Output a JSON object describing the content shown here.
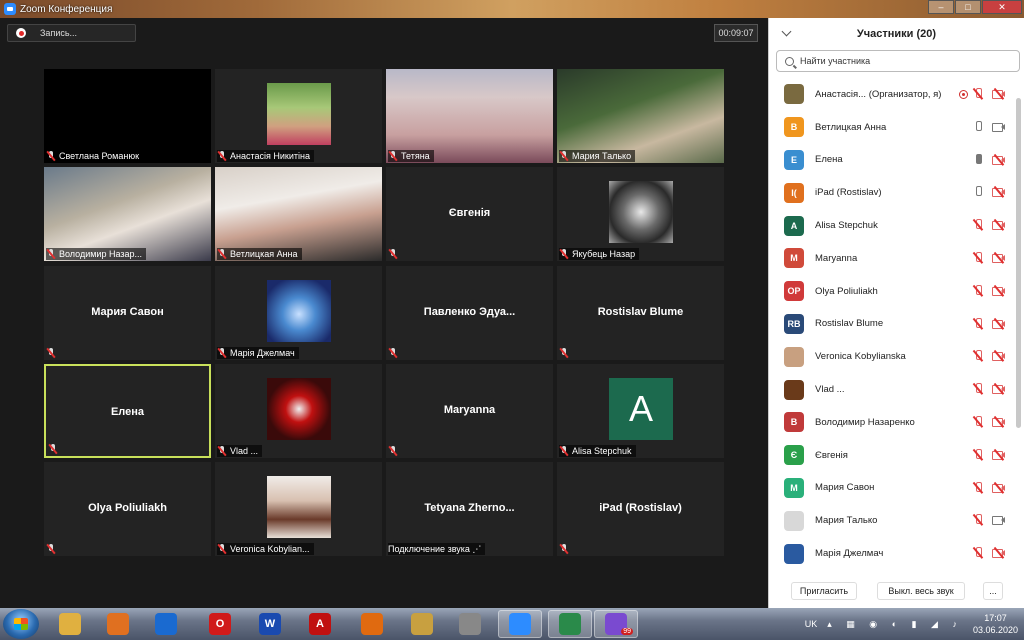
{
  "window": {
    "title": "Zoom Конференция"
  },
  "toolbar": {
    "record_label": "Запись...",
    "timer": "00:09:07"
  },
  "tiles": [
    {
      "name": "Светлана Романюк",
      "kind": "photo"
    },
    {
      "name": "Анастасія Никитіна",
      "kind": "thumb"
    },
    {
      "name": "Тетяна",
      "kind": "photo"
    },
    {
      "name": "Мария Талько",
      "kind": "photo"
    },
    {
      "name": "Володимир Назар...",
      "kind": "photo"
    },
    {
      "name": "Ветлицкая Анна",
      "kind": "photo"
    },
    {
      "name": "Євгенія",
      "kind": "center"
    },
    {
      "name": "Якубець Назар",
      "kind": "thumb"
    },
    {
      "name": "Мария Савон",
      "kind": "center"
    },
    {
      "name": "Марія Джелмач",
      "kind": "thumb"
    },
    {
      "name": "Павленко  Эдуа...",
      "kind": "center"
    },
    {
      "name": "Rostislav Blume",
      "kind": "center"
    },
    {
      "name": "Елена",
      "kind": "center"
    },
    {
      "name": "Vlad ...",
      "kind": "thumb"
    },
    {
      "name": "Maryanna",
      "kind": "center"
    },
    {
      "name": "Alisa Stepchuk",
      "kind": "letter"
    },
    {
      "name": "Olya Poliuliakh",
      "kind": "center"
    },
    {
      "name": "Veronica Kobylian...",
      "kind": "thumb"
    },
    {
      "name": "Tetyana  Zherno...",
      "kind": "center"
    },
    {
      "name": "iPad (Rostislav)",
      "kind": "center"
    }
  ],
  "tile_extra": {
    "connecting_audio": "Подключение звука",
    "alisa_letter": "A"
  },
  "panel": {
    "title": "Участники (20)",
    "search_placeholder": "Найти участника",
    "participants": [
      {
        "name": "Анастасія... (Организатор, я)",
        "initials": "",
        "color": "#7a6a40",
        "mic": "off",
        "cam": "off",
        "rec": true
      },
      {
        "name": "Ветлицкая Анна",
        "initials": "В",
        "color": "#f0961e",
        "mic": "on",
        "cam": "on"
      },
      {
        "name": "Елена",
        "initials": "Е",
        "color": "#3a8ed0",
        "mic": "live",
        "cam": "off"
      },
      {
        "name": "iPad (Rostislav)",
        "initials": "I(",
        "color": "#e0701e",
        "mic": "on",
        "cam": "off"
      },
      {
        "name": "Alisa Stepchuk",
        "initials": "A",
        "color": "#1c6a4e",
        "mic": "off",
        "cam": "off"
      },
      {
        "name": "Maryanna",
        "initials": "M",
        "color": "#d04a3a",
        "mic": "off",
        "cam": "off"
      },
      {
        "name": "Olya Poliuliakh",
        "initials": "OP",
        "color": "#d03a3a",
        "mic": "off",
        "cam": "off"
      },
      {
        "name": "Rostislav Blume",
        "initials": "RB",
        "color": "#2a4a78",
        "mic": "off",
        "cam": "off"
      },
      {
        "name": "Veronica Kobylianska",
        "initials": "",
        "color": "#c8a080",
        "mic": "off",
        "cam": "off"
      },
      {
        "name": "Vlad ...",
        "initials": "",
        "color": "#6a3a1a",
        "mic": "off",
        "cam": "off"
      },
      {
        "name": "Володимир Назаренко",
        "initials": "В",
        "color": "#c03a3a",
        "mic": "off",
        "cam": "off"
      },
      {
        "name": "Євгенія",
        "initials": "Є",
        "color": "#2aa04a",
        "mic": "off",
        "cam": "off"
      },
      {
        "name": "Мария Савон",
        "initials": "М",
        "color": "#2ab07a",
        "mic": "off",
        "cam": "off"
      },
      {
        "name": "Мария Талько",
        "initials": "",
        "color": "#d8d8d8",
        "mic": "off",
        "cam": "on"
      },
      {
        "name": "Марія Джелмач",
        "initials": "",
        "color": "#2a5aa0",
        "mic": "off",
        "cam": "off"
      }
    ],
    "invite": "Пригласить",
    "mute_all": "Выкл. весь звук",
    "more": "..."
  },
  "taskbar": {
    "lang": "UK",
    "time": "17:07",
    "date": "03.06.2020",
    "viber_badge": "99",
    "apps": [
      {
        "icon": "explorer-icon",
        "label": "",
        "color": "#e0b040"
      },
      {
        "icon": "media-player-icon",
        "label": "",
        "color": "#e07020"
      },
      {
        "icon": "teamviewer-icon",
        "label": "",
        "color": "#1a6ad0"
      },
      {
        "icon": "opera-icon",
        "label": "O",
        "color": "#d01a1a"
      },
      {
        "icon": "word-icon",
        "label": "W",
        "color": "#1a4ab0"
      },
      {
        "icon": "acrobat-icon",
        "label": "A",
        "color": "#c01010"
      },
      {
        "icon": "firefox-icon",
        "label": "",
        "color": "#e06a10"
      },
      {
        "icon": "settings-icon",
        "label": "",
        "color": "#c8a040"
      },
      {
        "icon": "film-icon",
        "label": "",
        "color": "#888888"
      },
      {
        "icon": "zoom-icon",
        "label": "",
        "color": "#2d8cff"
      },
      {
        "icon": "presentation-icon",
        "label": "",
        "color": "#2a8a4a"
      },
      {
        "icon": "viber-icon",
        "label": "",
        "color": "#7a4ad0"
      }
    ]
  }
}
